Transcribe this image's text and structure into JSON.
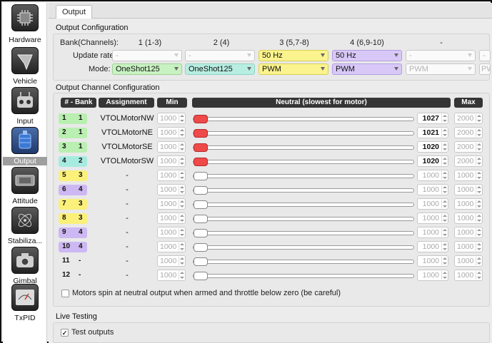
{
  "sidebar": {
    "items": [
      {
        "label": "Hardware",
        "icon": "chip-icon"
      },
      {
        "label": "Vehicle",
        "icon": "vehicle-icon"
      },
      {
        "label": "Input",
        "icon": "rc-transmitter-icon"
      },
      {
        "label": "Output",
        "icon": "motor-icon",
        "active": true
      },
      {
        "label": "Attitude",
        "icon": "attitude-board-icon"
      },
      {
        "label": "Stabiliza...",
        "icon": "stabilization-icon"
      },
      {
        "label": "Gimbal",
        "icon": "camera-icon"
      },
      {
        "label": "TxPID",
        "icon": "txpid-meter-icon"
      }
    ]
  },
  "tab": {
    "label": "Output"
  },
  "output_config": {
    "title": "Output Configuration",
    "bank_label": "Bank(Channels):",
    "update_rate_label": "Update rate:",
    "mode_label": "Mode:",
    "banks": [
      {
        "channels": "1 (1-3)",
        "rate": "-",
        "mode": "OneShot125"
      },
      {
        "channels": "2 (4)",
        "rate": "-",
        "mode": "OneShot125"
      },
      {
        "channels": "3 (5,7-8)",
        "rate": "50 Hz",
        "mode": "PWM"
      },
      {
        "channels": "4 (6,9-10)",
        "rate": "50 Hz",
        "mode": "PWM"
      },
      {
        "channels": "-",
        "rate": "-",
        "mode": "PWM"
      },
      {
        "channels": "",
        "rate": "-",
        "mode": "PW"
      }
    ]
  },
  "channel_config": {
    "title": "Output Channel Configuration",
    "headers": {
      "bank": "# - Bank",
      "assignment": "Assignment",
      "min": "Min",
      "neutral": "Neutral (slowest for motor)",
      "max": "Max"
    },
    "rows": [
      {
        "ch": "1",
        "bank": "1",
        "assignment": "VTOLMotorNW",
        "min": "1000",
        "neutral": "1027",
        "max": "2000",
        "color": "#b9efb0",
        "active": true
      },
      {
        "ch": "2",
        "bank": "1",
        "assignment": "VTOLMotorNE",
        "min": "1000",
        "neutral": "1021",
        "max": "2000",
        "color": "#b9efb0",
        "active": true
      },
      {
        "ch": "3",
        "bank": "1",
        "assignment": "VTOLMotorSE",
        "min": "1000",
        "neutral": "1020",
        "max": "2000",
        "color": "#b9efb0",
        "active": true
      },
      {
        "ch": "4",
        "bank": "2",
        "assignment": "VTOLMotorSW",
        "min": "1000",
        "neutral": "1020",
        "max": "2000",
        "color": "#a7ebe0",
        "active": true
      },
      {
        "ch": "5",
        "bank": "3",
        "assignment": "-",
        "min": "1000",
        "neutral": "1000",
        "max": "1000",
        "color": "#fbf07a",
        "active": false
      },
      {
        "ch": "6",
        "bank": "4",
        "assignment": "-",
        "min": "1000",
        "neutral": "1000",
        "max": "1000",
        "color": "#cdb8f3",
        "active": false
      },
      {
        "ch": "7",
        "bank": "3",
        "assignment": "-",
        "min": "1000",
        "neutral": "1000",
        "max": "1000",
        "color": "#fbf07a",
        "active": false
      },
      {
        "ch": "8",
        "bank": "3",
        "assignment": "-",
        "min": "1000",
        "neutral": "1000",
        "max": "1000",
        "color": "#fbf07a",
        "active": false
      },
      {
        "ch": "9",
        "bank": "4",
        "assignment": "-",
        "min": "1000",
        "neutral": "1000",
        "max": "1000",
        "color": "#cdb8f3",
        "active": false
      },
      {
        "ch": "10",
        "bank": "4",
        "assignment": "-",
        "min": "1000",
        "neutral": "1000",
        "max": "1000",
        "color": "#cdb8f3",
        "active": false
      },
      {
        "ch": "11",
        "bank": "-",
        "assignment": "-",
        "min": "1000",
        "neutral": "1000",
        "max": "1000",
        "color": "",
        "active": false
      },
      {
        "ch": "12",
        "bank": "-",
        "assignment": "-",
        "min": "1000",
        "neutral": "1000",
        "max": "1000",
        "color": "",
        "active": false
      }
    ],
    "spin_checkbox_label": "Motors spin at neutral output when armed and throttle below zero (be careful)",
    "spin_checked": false
  },
  "live_testing": {
    "title": "Live Testing",
    "checkbox_label": "Test outputs",
    "checked": true,
    "check_glyph": "✓"
  },
  "colors": {
    "slider_handle_active": "#ef4a4a",
    "slider_fill": "#3b78e7"
  }
}
